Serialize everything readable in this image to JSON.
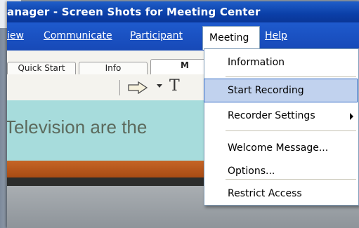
{
  "window": {
    "title": "anager - Screen Shots for Meeting Center"
  },
  "menubar": {
    "items": [
      {
        "label": "iew"
      },
      {
        "label": "Communicate"
      },
      {
        "label": "Participant"
      },
      {
        "label": "Meeting"
      },
      {
        "label": "Help"
      }
    ]
  },
  "tabs": [
    {
      "label": "Quick Start"
    },
    {
      "label": "Info"
    },
    {
      "label": "M"
    }
  ],
  "toolbar": {
    "icons": [
      "arrow-icon",
      "dropdown-arrow-icon",
      "text-tool-icon"
    ],
    "text_tool_glyph": "T"
  },
  "content": {
    "headline": "Television are the",
    "colors": {
      "panel": "#a7dcdc",
      "accent_band": "#c56526"
    }
  },
  "meeting_menu": {
    "items": [
      {
        "label": "Information"
      },
      {
        "label": "Start Recording",
        "highlighted": true
      },
      {
        "label": "Recorder Settings",
        "has_submenu": true
      },
      {
        "label": "Welcome Message..."
      },
      {
        "label": "Options..."
      },
      {
        "label": "Restrict Access"
      }
    ]
  },
  "colors": {
    "titlebar": "#0b3fa8",
    "menubar": "#1e5acd",
    "menu_highlight": "#c1d2ee"
  }
}
